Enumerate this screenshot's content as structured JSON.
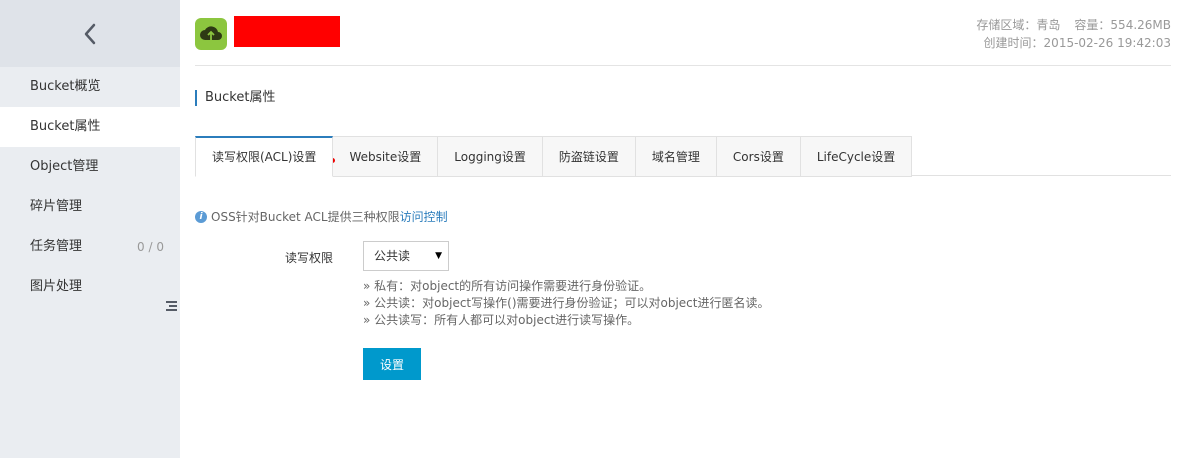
{
  "sidebar": {
    "back_icon": "chevron-left-icon",
    "items": [
      {
        "label": "Bucket概览"
      },
      {
        "label": "Bucket属性"
      },
      {
        "label": "Object管理"
      },
      {
        "label": "碎片管理"
      },
      {
        "label": "任务管理",
        "count": "0 / 0"
      },
      {
        "label": "图片处理"
      }
    ],
    "active_index": 1,
    "toggle_icon": "collapse-menu-icon"
  },
  "header": {
    "logo_icon": "cloud-upload-icon",
    "storage_region": "存储区域：青岛",
    "capacity": "容量：554.26MB",
    "created_time": "创建时间：2015-02-26 19:42:03"
  },
  "section": {
    "title": "Bucket属性"
  },
  "tabs": [
    {
      "label": "读写权限(ACL)设置",
      "active": true
    },
    {
      "label": "Website设置"
    },
    {
      "label": "Logging设置"
    },
    {
      "label": "防盗链设置"
    },
    {
      "label": "域名管理"
    },
    {
      "label": "Cors设置"
    },
    {
      "label": "LifeCycle设置"
    }
  ],
  "info": {
    "icon": "info-icon",
    "text": "OSS针对Bucket ACL提供三种权限",
    "link": "访问控制"
  },
  "form": {
    "label": "读写权限",
    "selected": "公共读",
    "hints": [
      "» 私有：对object的所有访问操作需要进行身份验证。",
      "» 公共读：对object写操作()需要进行身份验证；可以对object进行匿名读。",
      "» 公共读写：所有人都可以对object进行读写操作。"
    ],
    "submit_label": "设置"
  },
  "colors": {
    "accent": "#2b7dbc",
    "button": "#0099cc",
    "redacted": "#ff0000",
    "logo": "#8cc63f"
  }
}
